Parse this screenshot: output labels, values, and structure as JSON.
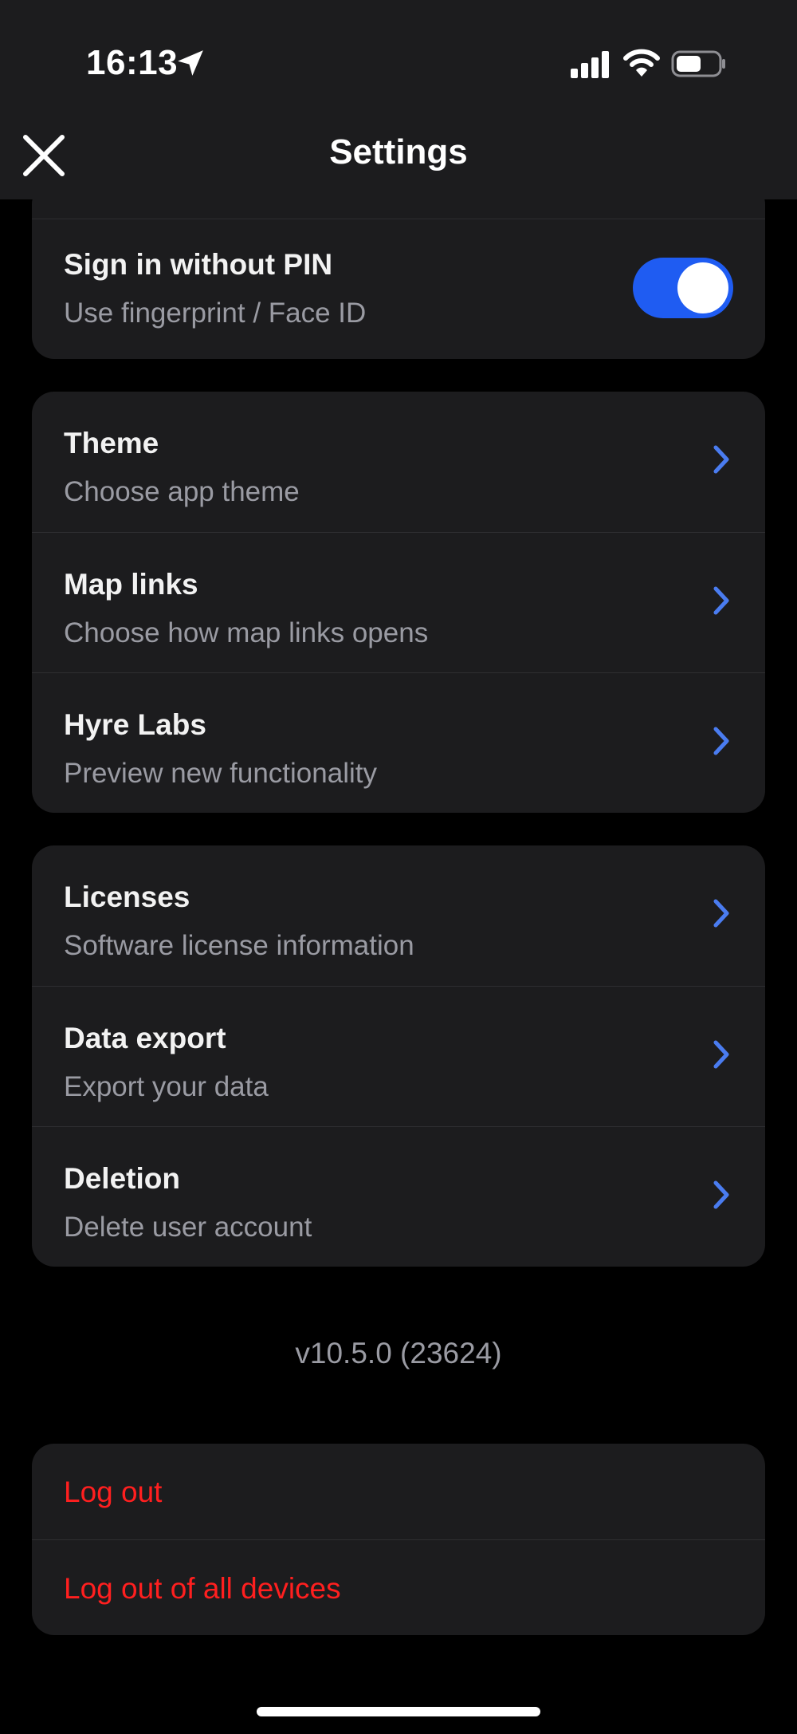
{
  "status_bar": {
    "time": "16:13",
    "location_icon": "location-arrow-icon",
    "signal_icon": "cellular-signal-icon",
    "wifi_icon": "wifi-icon",
    "battery_icon": "battery-icon"
  },
  "nav": {
    "title": "Settings",
    "close_icon": "close-icon"
  },
  "security_card": {
    "sign_in_without_pin": {
      "title": "Sign in without PIN",
      "subtitle": "Use fingerprint / Face ID",
      "enabled": true
    }
  },
  "preferences_card": {
    "items": [
      {
        "title": "Theme",
        "subtitle": "Choose app theme"
      },
      {
        "title": "Map links",
        "subtitle": "Choose how map links opens"
      },
      {
        "title": "Hyre Labs",
        "subtitle": "Preview new functionality"
      }
    ]
  },
  "account_card": {
    "items": [
      {
        "title": "Licenses",
        "subtitle": "Software license information"
      },
      {
        "title": "Data export",
        "subtitle": "Export your data"
      },
      {
        "title": "Deletion",
        "subtitle": "Delete user account"
      }
    ]
  },
  "version": "v10.5.0 (23624)",
  "logout_card": {
    "log_out": "Log out",
    "log_out_all": "Log out of all devices"
  },
  "colors": {
    "accent": "#1f5cf2",
    "chevron": "#4a7cf0",
    "danger": "#ff1f1f",
    "card_bg": "#1c1c1e",
    "background": "#000000"
  }
}
